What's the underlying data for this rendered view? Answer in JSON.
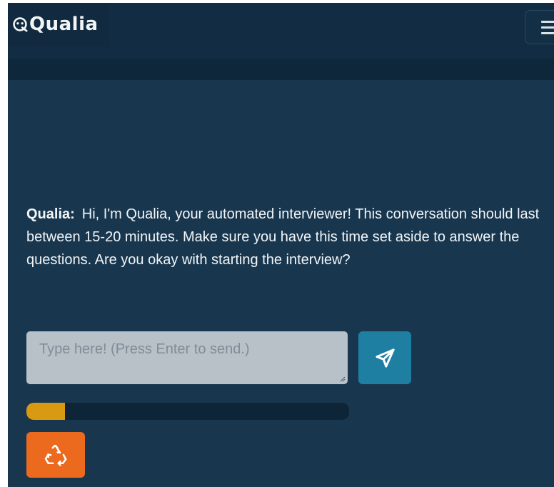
{
  "header": {
    "brand": "Qualia",
    "logo_icon": "qualia-logo-icon",
    "menu_icon": "menu-icon"
  },
  "chat": {
    "messages": [
      {
        "speaker": "Qualia:",
        "text": "Hi, I'm Qualia, your automated interviewer! This conversation should last between 15-20 minutes. Make sure you have this time set aside to answer the questions. Are you okay with starting the interview?"
      }
    ]
  },
  "composer": {
    "placeholder": "Type here! (Press Enter to send.)",
    "value": "",
    "send_icon": "paper-plane-icon"
  },
  "progress": {
    "value": 0.12,
    "color": "#d99912"
  },
  "actions": {
    "restart_icon": "recycle-icon"
  },
  "colors": {
    "background": "#17354c",
    "header": "#122d43",
    "send_button": "#1f7fa3",
    "restart_button": "#ec6a1d",
    "input": "#b8c0c8"
  }
}
